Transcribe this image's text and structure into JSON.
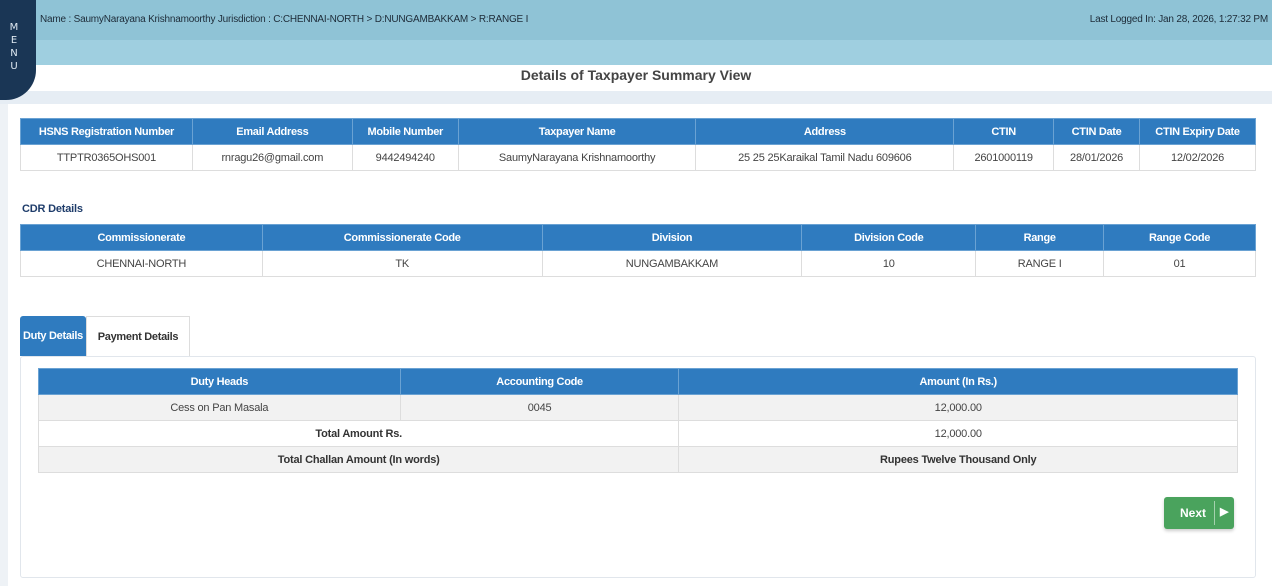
{
  "header": {
    "name_line": "Name : SaumyNarayana Krishnamoorthy   Jurisdiction : C:CHENNAI-NORTH > D:NUNGAMBAKKAM > R:RANGE I",
    "last_logged": "Last Logged In: Jan 28, 2026, 1:27:32 PM",
    "menu_letters": [
      "M",
      "E",
      "N",
      "U"
    ]
  },
  "page_title": "Details of Taxpayer Summary View",
  "taxpayer": {
    "headers": [
      "HSNS Registration Number",
      "Email Address",
      "Mobile Number",
      "Taxpayer Name",
      "Address",
      "CTIN",
      "CTIN Date",
      "CTIN Expiry Date"
    ],
    "row": [
      "TTPTR0365OHS001",
      "rnragu26@gmail.com",
      "9442494240",
      "SaumyNarayana Krishnamoorthy",
      "25 25 25Karaikal Tamil Nadu 609606",
      "2601000119",
      "28/01/2026",
      "12/02/2026"
    ]
  },
  "cdr": {
    "label": "CDR Details",
    "headers": [
      "Commissionerate",
      "Commissionerate Code",
      "Division",
      "Division Code",
      "Range",
      "Range Code"
    ],
    "row": [
      "CHENNAI-NORTH",
      "TK",
      "NUNGAMBAKKAM",
      "10",
      "RANGE I",
      "01"
    ]
  },
  "tabs": {
    "duty": "Duty Details",
    "payment": "Payment Details"
  },
  "duty": {
    "headers": [
      "Duty Heads",
      "Accounting Code",
      "Amount (In Rs.)"
    ],
    "rows": [
      [
        "Cess on Pan Masala",
        "0045",
        "12,000.00"
      ]
    ],
    "total_label": "Total Amount Rs.",
    "total_value": "12,000.00",
    "words_label": "Total Challan Amount (In words)",
    "words_value": "Rupees Twelve Thousand Only"
  },
  "next_button": {
    "label": "Next",
    "arrow": "▶"
  },
  "colors": {
    "header_bg": "#8fc3d6",
    "table_head": "#2f7bbf",
    "menu": "#1a3655",
    "next": "#4aa35d"
  }
}
